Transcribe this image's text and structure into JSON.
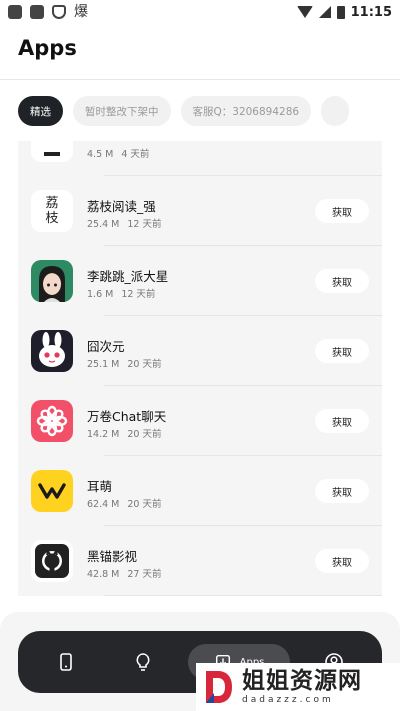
{
  "status_bar": {
    "time": "11:15",
    "left_glyph": "爆"
  },
  "header": {
    "title": "Apps"
  },
  "chips": [
    {
      "label": "精选",
      "active": true
    },
    {
      "label": "暂时整改下架中",
      "active": false
    },
    {
      "label": "客服Q：3206894286",
      "active": false
    },
    {
      "label": "",
      "active": false
    }
  ],
  "apps": [
    {
      "name": "",
      "size": "4.5 M",
      "age": "4 天前",
      "icon": "partial-app-icon",
      "button": "获取"
    },
    {
      "name": "荔枝阅读_强",
      "size": "25.4 M",
      "age": "12 天前",
      "icon": "lizhi-calligraphy-icon",
      "icon_text": "荔枝",
      "button": "获取"
    },
    {
      "name": "李跳跳_派大星",
      "size": "1.6 M",
      "age": "12 天前",
      "icon": "anime-girl-avatar-icon",
      "button": "获取"
    },
    {
      "name": "囧次元",
      "size": "25.1 M",
      "age": "20 天前",
      "icon": "rabbit-mascot-icon",
      "button": "获取"
    },
    {
      "name": "万卷Chat聊天",
      "size": "14.2 M",
      "age": "20 天前",
      "icon": "flower-logo-icon",
      "button": "获取"
    },
    {
      "name": "耳萌",
      "size": "62.4 M",
      "age": "20 天前",
      "icon": "crown-m-logo-icon",
      "button": "获取"
    },
    {
      "name": "黑锚影视",
      "size": "42.8 M",
      "age": "27 天前",
      "icon": "github-octocat-icon",
      "button": "获取"
    }
  ],
  "nav": {
    "items": [
      {
        "icon": "phone-icon",
        "label": ""
      },
      {
        "icon": "lightbulb-icon",
        "label": ""
      },
      {
        "icon": "download-icon",
        "label": "Apps"
      },
      {
        "icon": "user-icon",
        "label": ""
      }
    ]
  },
  "watermark": {
    "title": "姐姐资源网",
    "subtitle": "dadazzz.com"
  },
  "colors": {
    "accent_dark": "#1f2227",
    "nav_bg": "#25272b",
    "panel_bg": "#f5f5f5",
    "app_pink": "#f25068",
    "app_yellow": "#ffd21f"
  }
}
